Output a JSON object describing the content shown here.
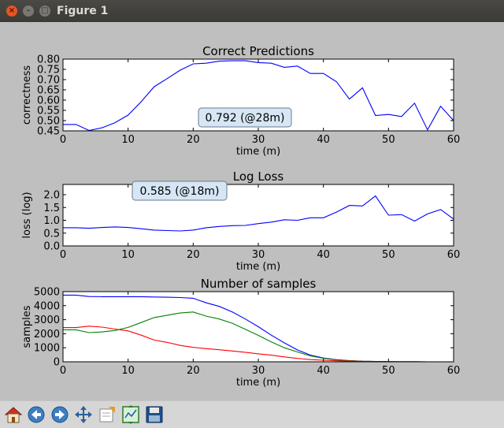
{
  "window": {
    "title": "Figure 1",
    "close_glyph": "×",
    "min_glyph": "–",
    "max_glyph": "□"
  },
  "toolbar": {
    "buttons": [
      {
        "name": "home-icon"
      },
      {
        "name": "back-icon"
      },
      {
        "name": "forward-icon"
      },
      {
        "name": "pan-icon"
      },
      {
        "name": "zoom-icon"
      },
      {
        "name": "subplots-icon"
      },
      {
        "name": "save-icon"
      }
    ]
  },
  "chart_data": [
    {
      "type": "line",
      "title": "Correct Predictions",
      "xlabel": "time (m)",
      "ylabel": "correctness",
      "xlim": [
        0,
        60
      ],
      "ylim": [
        0.45,
        0.8
      ],
      "xticks": [
        "0",
        "10",
        "20",
        "30",
        "40",
        "50",
        "60"
      ],
      "yticks": [
        "0.45",
        "0.50",
        "0.55",
        "0.60",
        "0.65",
        "0.70",
        "0.75",
        "0.80"
      ],
      "annotation": "0.792 (@28m)",
      "series": [
        {
          "color": "#0000ff",
          "x": [
            0,
            2,
            4,
            6,
            8,
            10,
            12,
            14,
            16,
            18,
            20,
            22,
            24,
            26,
            28,
            30,
            32,
            34,
            36,
            38,
            40,
            42,
            44,
            46,
            48,
            50,
            52,
            54,
            56,
            58,
            60
          ],
          "y": [
            0.481,
            0.481,
            0.452,
            0.465,
            0.49,
            0.527,
            0.592,
            0.665,
            0.705,
            0.746,
            0.777,
            0.78,
            0.79,
            0.792,
            0.792,
            0.783,
            0.78,
            0.76,
            0.766,
            0.73,
            0.73,
            0.69,
            0.605,
            0.66,
            0.525,
            0.53,
            0.52,
            0.585,
            0.455,
            0.57,
            0.5
          ]
        }
      ]
    },
    {
      "type": "line",
      "title": "Log Loss",
      "xlabel": "time (m)",
      "ylabel": "loss (log)",
      "xlim": [
        0,
        60
      ],
      "ylim": [
        0,
        2.4
      ],
      "xticks": [
        "0",
        "10",
        "20",
        "30",
        "40",
        "50",
        "60"
      ],
      "yticks": [
        "0.0",
        "0.5",
        "1.0",
        "1.5",
        "2.0"
      ],
      "annotation": "0.585 (@18m)",
      "series": [
        {
          "color": "#0000ff",
          "x": [
            0,
            2,
            4,
            6,
            8,
            10,
            12,
            14,
            16,
            18,
            20,
            22,
            24,
            26,
            28,
            30,
            32,
            34,
            36,
            38,
            40,
            42,
            44,
            46,
            48,
            50,
            52,
            54,
            56,
            58,
            60
          ],
          "y": [
            0.71,
            0.71,
            0.69,
            0.72,
            0.74,
            0.72,
            0.67,
            0.62,
            0.6,
            0.585,
            0.62,
            0.71,
            0.76,
            0.79,
            0.8,
            0.87,
            0.93,
            1.02,
            1.0,
            1.1,
            1.1,
            1.32,
            1.58,
            1.56,
            1.95,
            1.2,
            1.22,
            0.97,
            1.25,
            1.42,
            1.05
          ]
        }
      ]
    },
    {
      "type": "line",
      "title": "Number of samples",
      "xlabel": "time (m)",
      "ylabel": "samples",
      "xlim": [
        0,
        60
      ],
      "ylim": [
        0,
        5000
      ],
      "xticks": [
        "0",
        "10",
        "20",
        "30",
        "40",
        "50",
        "60"
      ],
      "yticks": [
        "0",
        "1000",
        "2000",
        "3000",
        "4000",
        "5000"
      ],
      "series": [
        {
          "color": "#0000ff",
          "x": [
            0,
            2,
            4,
            6,
            8,
            10,
            12,
            14,
            16,
            18,
            20,
            22,
            24,
            26,
            28,
            30,
            32,
            34,
            36,
            38,
            40,
            42,
            44,
            46,
            48,
            50,
            52,
            54,
            56,
            58,
            60
          ],
          "y": [
            4750,
            4750,
            4650,
            4640,
            4640,
            4640,
            4640,
            4620,
            4600,
            4580,
            4530,
            4200,
            3950,
            3550,
            3050,
            2500,
            1900,
            1350,
            850,
            480,
            270,
            150,
            80,
            40,
            20,
            10,
            5,
            3,
            2,
            1,
            0
          ]
        },
        {
          "color": "#008000",
          "x": [
            0,
            2,
            4,
            6,
            8,
            10,
            12,
            14,
            16,
            18,
            20,
            22,
            24,
            26,
            28,
            30,
            32,
            34,
            36,
            38,
            40,
            42,
            44,
            46,
            48,
            50,
            52,
            54,
            56,
            58,
            60
          ],
          "y": [
            2280,
            2280,
            2080,
            2130,
            2230,
            2450,
            2800,
            3150,
            3320,
            3480,
            3550,
            3250,
            3050,
            2750,
            2320,
            1880,
            1420,
            1000,
            700,
            420,
            250,
            140,
            80,
            40,
            20,
            10,
            5,
            3,
            2,
            1,
            0
          ]
        },
        {
          "color": "#ff0000",
          "x": [
            0,
            2,
            4,
            6,
            8,
            10,
            12,
            14,
            16,
            18,
            20,
            22,
            24,
            26,
            28,
            30,
            32,
            34,
            36,
            38,
            40,
            42,
            44,
            46,
            48,
            50,
            52,
            54,
            56,
            58,
            60
          ],
          "y": [
            2440,
            2440,
            2540,
            2470,
            2330,
            2200,
            1900,
            1550,
            1380,
            1170,
            1030,
            940,
            860,
            770,
            680,
            570,
            470,
            350,
            240,
            160,
            110,
            75,
            50,
            35,
            20,
            10,
            5,
            3,
            2,
            1,
            0
          ]
        }
      ]
    }
  ]
}
